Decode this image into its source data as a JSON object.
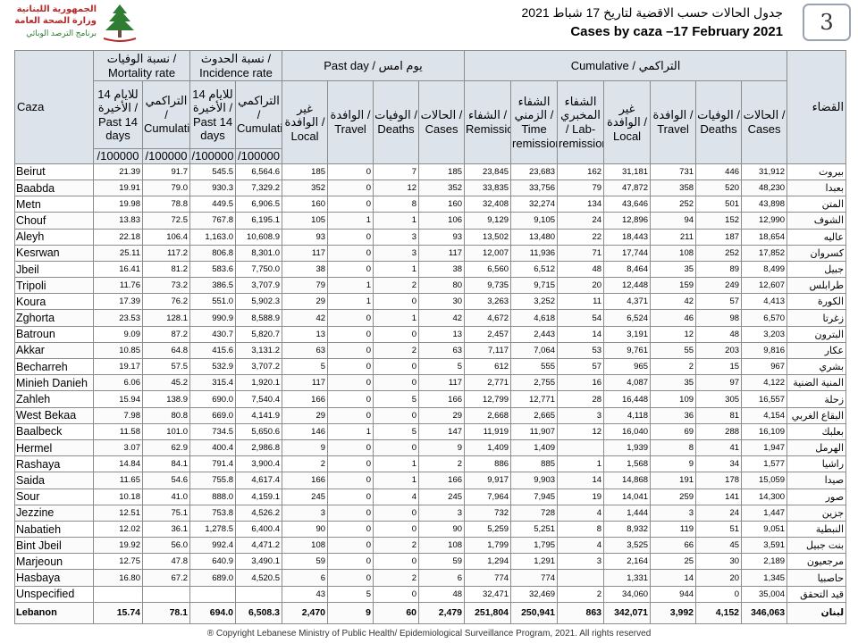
{
  "header": {
    "logo_ar_line1": "الجمهورية اللبنانية",
    "logo_ar_line2": "وزارة الصحة العامة",
    "logo_ar_line3": "برنامج الترصد الوبائي",
    "title_ar": "جدول الحالات حسب الاقضية لتاريخ 17 شباط 2021",
    "title_en": "Cases by caza –17 February 2021",
    "page_number": "3"
  },
  "columns": {
    "caza": "Caza",
    "qada": "القضاء",
    "mortality_group": "نسبة الوفيات / Mortality rate",
    "incidence_group": "نسبة الحدوث / Incidence rate",
    "pastday_group": "Past day / يوم امس",
    "cumulative_group": "Cumulative / التراكمي",
    "mort_14": "للايام 14 الأخيرة / Past 14 days",
    "mort_cum": "التراكمي / Cumulative",
    "inc_14": "للايام 14 الأخيرة / Past 14 days",
    "inc_cum": "التراكمي / Cumulative",
    "pd_local": "غير الوافدة / Local",
    "pd_travel": "الوافدة / Travel",
    "pd_deaths": "الوفيات / Deaths",
    "pd_cases": "الحالات / Cases",
    "c_remission": "الشفاء / Remission",
    "c_time": "الشفاء الزمني / Time remission",
    "c_lab": "الشفاء المخبري / Lab-remission",
    "c_local": "غير الوافدة / Local",
    "c_travel": "الوافدة / Travel",
    "c_deaths": "الوفيات / Deaths",
    "c_cases": "الحالات / Cases",
    "unit": "/100000"
  },
  "rows": [
    {
      "caza": "Beirut",
      "m14": "21.39",
      "mcum": "91.7",
      "i14": "545.5",
      "icum": "6,564.6",
      "pl": "185",
      "pt": "0",
      "pdth": "7",
      "pc": "185",
      "rem": "23,845",
      "trem": "23,683",
      "lrem": "162",
      "loc": "31,181",
      "trv": "731",
      "dth": "446",
      "cs": "31,912",
      "qada": "بيروت"
    },
    {
      "caza": "Baabda",
      "m14": "19.91",
      "mcum": "79.0",
      "i14": "930.3",
      "icum": "7,329.2",
      "pl": "352",
      "pt": "0",
      "pdth": "12",
      "pc": "352",
      "rem": "33,835",
      "trem": "33,756",
      "lrem": "79",
      "loc": "47,872",
      "trv": "358",
      "dth": "520",
      "cs": "48,230",
      "qada": "بعبدا"
    },
    {
      "caza": "Metn",
      "m14": "19.98",
      "mcum": "78.8",
      "i14": "449.5",
      "icum": "6,906.5",
      "pl": "160",
      "pt": "0",
      "pdth": "8",
      "pc": "160",
      "rem": "32,408",
      "trem": "32,274",
      "lrem": "134",
      "loc": "43,646",
      "trv": "252",
      "dth": "501",
      "cs": "43,898",
      "qada": "المتن"
    },
    {
      "caza": "Chouf",
      "m14": "13.83",
      "mcum": "72.5",
      "i14": "767.8",
      "icum": "6,195.1",
      "pl": "105",
      "pt": "1",
      "pdth": "1",
      "pc": "106",
      "rem": "9,129",
      "trem": "9,105",
      "lrem": "24",
      "loc": "12,896",
      "trv": "94",
      "dth": "152",
      "cs": "12,990",
      "qada": "الشوف"
    },
    {
      "caza": "Aleyh",
      "m14": "22.18",
      "mcum": "106.4",
      "i14": "1,163.0",
      "icum": "10,608.9",
      "pl": "93",
      "pt": "0",
      "pdth": "3",
      "pc": "93",
      "rem": "13,502",
      "trem": "13,480",
      "lrem": "22",
      "loc": "18,443",
      "trv": "211",
      "dth": "187",
      "cs": "18,654",
      "qada": "عاليه"
    },
    {
      "caza": "Kesrwan",
      "m14": "25.11",
      "mcum": "117.2",
      "i14": "806.8",
      "icum": "8,301.0",
      "pl": "117",
      "pt": "0",
      "pdth": "3",
      "pc": "117",
      "rem": "12,007",
      "trem": "11,936",
      "lrem": "71",
      "loc": "17,744",
      "trv": "108",
      "dth": "252",
      "cs": "17,852",
      "qada": "كسروان"
    },
    {
      "caza": "Jbeil",
      "m14": "16.41",
      "mcum": "81.2",
      "i14": "583.6",
      "icum": "7,750.0",
      "pl": "38",
      "pt": "0",
      "pdth": "1",
      "pc": "38",
      "rem": "6,560",
      "trem": "6,512",
      "lrem": "48",
      "loc": "8,464",
      "trv": "35",
      "dth": "89",
      "cs": "8,499",
      "qada": "جبيل"
    },
    {
      "caza": "Tripoli",
      "m14": "11.76",
      "mcum": "73.2",
      "i14": "386.5",
      "icum": "3,707.9",
      "pl": "79",
      "pt": "1",
      "pdth": "2",
      "pc": "80",
      "rem": "9,735",
      "trem": "9,715",
      "lrem": "20",
      "loc": "12,448",
      "trv": "159",
      "dth": "249",
      "cs": "12,607",
      "qada": "طرابلس"
    },
    {
      "caza": "Koura",
      "m14": "17.39",
      "mcum": "76.2",
      "i14": "551.0",
      "icum": "5,902.3",
      "pl": "29",
      "pt": "1",
      "pdth": "0",
      "pc": "30",
      "rem": "3,263",
      "trem": "3,252",
      "lrem": "11",
      "loc": "4,371",
      "trv": "42",
      "dth": "57",
      "cs": "4,413",
      "qada": "الكورة"
    },
    {
      "caza": "Zghorta",
      "m14": "23.53",
      "mcum": "128.1",
      "i14": "990.9",
      "icum": "8,588.9",
      "pl": "42",
      "pt": "0",
      "pdth": "1",
      "pc": "42",
      "rem": "4,672",
      "trem": "4,618",
      "lrem": "54",
      "loc": "6,524",
      "trv": "46",
      "dth": "98",
      "cs": "6,570",
      "qada": "زغرتا"
    },
    {
      "caza": "Batroun",
      "m14": "9.09",
      "mcum": "87.2",
      "i14": "430.7",
      "icum": "5,820.7",
      "pl": "13",
      "pt": "0",
      "pdth": "0",
      "pc": "13",
      "rem": "2,457",
      "trem": "2,443",
      "lrem": "14",
      "loc": "3,191",
      "trv": "12",
      "dth": "48",
      "cs": "3,203",
      "qada": "البترون"
    },
    {
      "caza": "Akkar",
      "m14": "10.85",
      "mcum": "64.8",
      "i14": "415.6",
      "icum": "3,131.2",
      "pl": "63",
      "pt": "0",
      "pdth": "2",
      "pc": "63",
      "rem": "7,117",
      "trem": "7,064",
      "lrem": "53",
      "loc": "9,761",
      "trv": "55",
      "dth": "203",
      "cs": "9,816",
      "qada": "عكار"
    },
    {
      "caza": "Becharreh",
      "m14": "19.17",
      "mcum": "57.5",
      "i14": "532.9",
      "icum": "3,707.2",
      "pl": "5",
      "pt": "0",
      "pdth": "0",
      "pc": "5",
      "rem": "612",
      "trem": "555",
      "lrem": "57",
      "loc": "965",
      "trv": "2",
      "dth": "15",
      "cs": "967",
      "qada": "بشري"
    },
    {
      "caza": "Minieh Danieh",
      "m14": "6.06",
      "mcum": "45.2",
      "i14": "315.4",
      "icum": "1,920.1",
      "pl": "117",
      "pt": "0",
      "pdth": "0",
      "pc": "117",
      "rem": "2,771",
      "trem": "2,755",
      "lrem": "16",
      "loc": "4,087",
      "trv": "35",
      "dth": "97",
      "cs": "4,122",
      "qada": "المنية الضنية"
    },
    {
      "caza": "Zahleh",
      "m14": "15.94",
      "mcum": "138.9",
      "i14": "690.0",
      "icum": "7,540.4",
      "pl": "166",
      "pt": "0",
      "pdth": "5",
      "pc": "166",
      "rem": "12,799",
      "trem": "12,771",
      "lrem": "28",
      "loc": "16,448",
      "trv": "109",
      "dth": "305",
      "cs": "16,557",
      "qada": "زحلة"
    },
    {
      "caza": "West Bekaa",
      "m14": "7.98",
      "mcum": "80.8",
      "i14": "669.0",
      "icum": "4,141.9",
      "pl": "29",
      "pt": "0",
      "pdth": "0",
      "pc": "29",
      "rem": "2,668",
      "trem": "2,665",
      "lrem": "3",
      "loc": "4,118",
      "trv": "36",
      "dth": "81",
      "cs": "4,154",
      "qada": "البقاع الغربي"
    },
    {
      "caza": "Baalbeck",
      "m14": "11.58",
      "mcum": "101.0",
      "i14": "734.5",
      "icum": "5,650.6",
      "pl": "146",
      "pt": "1",
      "pdth": "5",
      "pc": "147",
      "rem": "11,919",
      "trem": "11,907",
      "lrem": "12",
      "loc": "16,040",
      "trv": "69",
      "dth": "288",
      "cs": "16,109",
      "qada": "بعلبك"
    },
    {
      "caza": "Hermel",
      "m14": "3.07",
      "mcum": "62.9",
      "i14": "400.4",
      "icum": "2,986.8",
      "pl": "9",
      "pt": "0",
      "pdth": "0",
      "pc": "9",
      "rem": "1,409",
      "trem": "1,409",
      "lrem": "",
      "loc": "1,939",
      "trv": "8",
      "dth": "41",
      "cs": "1,947",
      "qada": "الهرمل"
    },
    {
      "caza": "Rashaya",
      "m14": "14.84",
      "mcum": "84.1",
      "i14": "791.4",
      "icum": "3,900.4",
      "pl": "2",
      "pt": "0",
      "pdth": "1",
      "pc": "2",
      "rem": "886",
      "trem": "885",
      "lrem": "1",
      "loc": "1,568",
      "trv": "9",
      "dth": "34",
      "cs": "1,577",
      "qada": "راشيا"
    },
    {
      "caza": "Saida",
      "m14": "11.65",
      "mcum": "54.6",
      "i14": "755.8",
      "icum": "4,617.4",
      "pl": "166",
      "pt": "0",
      "pdth": "1",
      "pc": "166",
      "rem": "9,917",
      "trem": "9,903",
      "lrem": "14",
      "loc": "14,868",
      "trv": "191",
      "dth": "178",
      "cs": "15,059",
      "qada": "صيدا"
    },
    {
      "caza": "Sour",
      "m14": "10.18",
      "mcum": "41.0",
      "i14": "888.0",
      "icum": "4,159.1",
      "pl": "245",
      "pt": "0",
      "pdth": "4",
      "pc": "245",
      "rem": "7,964",
      "trem": "7,945",
      "lrem": "19",
      "loc": "14,041",
      "trv": "259",
      "dth": "141",
      "cs": "14,300",
      "qada": "صور"
    },
    {
      "caza": "Jezzine",
      "m14": "12.51",
      "mcum": "75.1",
      "i14": "753.8",
      "icum": "4,526.2",
      "pl": "3",
      "pt": "0",
      "pdth": "0",
      "pc": "3",
      "rem": "732",
      "trem": "728",
      "lrem": "4",
      "loc": "1,444",
      "trv": "3",
      "dth": "24",
      "cs": "1,447",
      "qada": "جزين"
    },
    {
      "caza": "Nabatieh",
      "m14": "12.02",
      "mcum": "36.1",
      "i14": "1,278.5",
      "icum": "6,400.4",
      "pl": "90",
      "pt": "0",
      "pdth": "0",
      "pc": "90",
      "rem": "5,259",
      "trem": "5,251",
      "lrem": "8",
      "loc": "8,932",
      "trv": "119",
      "dth": "51",
      "cs": "9,051",
      "qada": "النبطية"
    },
    {
      "caza": "Bint Jbeil",
      "m14": "19.92",
      "mcum": "56.0",
      "i14": "992.4",
      "icum": "4,471.2",
      "pl": "108",
      "pt": "0",
      "pdth": "2",
      "pc": "108",
      "rem": "1,799",
      "trem": "1,795",
      "lrem": "4",
      "loc": "3,525",
      "trv": "66",
      "dth": "45",
      "cs": "3,591",
      "qada": "بنت جبيل"
    },
    {
      "caza": "Marjeoun",
      "m14": "12.75",
      "mcum": "47.8",
      "i14": "640.9",
      "icum": "3,490.1",
      "pl": "59",
      "pt": "0",
      "pdth": "0",
      "pc": "59",
      "rem": "1,294",
      "trem": "1,291",
      "lrem": "3",
      "loc": "2,164",
      "trv": "25",
      "dth": "30",
      "cs": "2,189",
      "qada": "مرجعيون"
    },
    {
      "caza": "Hasbaya",
      "m14": "16.80",
      "mcum": "67.2",
      "i14": "689.0",
      "icum": "4,520.5",
      "pl": "6",
      "pt": "0",
      "pdth": "2",
      "pc": "6",
      "rem": "774",
      "trem": "774",
      "lrem": "",
      "loc": "1,331",
      "trv": "14",
      "dth": "20",
      "cs": "1,345",
      "qada": "حاصبيا"
    },
    {
      "caza": "Unspecified",
      "m14": "",
      "mcum": "",
      "i14": "",
      "icum": "",
      "pl": "43",
      "pt": "5",
      "pdth": "0",
      "pc": "48",
      "rem": "32,471",
      "trem": "32,469",
      "lrem": "2",
      "loc": "34,060",
      "trv": "944",
      "dth": "0",
      "cs": "35,004",
      "qada": "قيد التحقق"
    }
  ],
  "total": {
    "caza": "Lebanon",
    "m14": "15.74",
    "mcum": "78.1",
    "i14": "694.0",
    "icum": "6,508.3",
    "pl": "2,470",
    "pt": "9",
    "pdth": "60",
    "pc": "2,479",
    "rem": "251,804",
    "trem": "250,941",
    "lrem": "863",
    "loc": "342,071",
    "trv": "3,992",
    "dth": "4,152",
    "cs": "346,063",
    "qada": "لبنان"
  },
  "footer": "® Copyright Lebanese Ministry of Public Health/ Epidemiological Surveillance Program, 2021. All rights reserved"
}
